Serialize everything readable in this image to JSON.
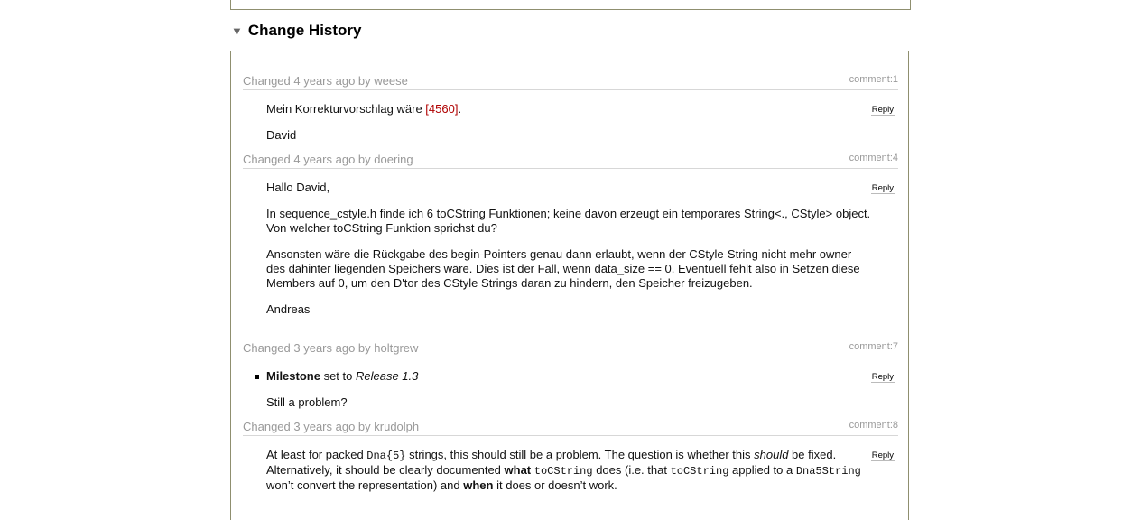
{
  "section": {
    "title": "Change History",
    "toggle_icon": "triangle-down-icon"
  },
  "changes": [
    {
      "meta": "Changed 4 years ago by weese",
      "comment_id": "comment:1",
      "reply": "Reply",
      "paragraphs": [
        "Mein Korrekturvorschlag wäre ",
        "[4560]",
        ".",
        "David"
      ]
    },
    {
      "meta": "Changed 4 years ago by doering",
      "comment_id": "comment:4",
      "reply": "Reply",
      "paragraphs": [
        "Hallo David,",
        "In sequence_cstyle.h finde ich 6 toCString Funktionen; keine davon erzeugt ein temporares String<., CStyle> object. Von welcher toCString Funktion sprichst du?",
        "Ansonsten wäre die Rückgabe des begin-Pointers genau dann erlaubt, wenn der CStyle-String nicht mehr owner des dahinter liegenden Speichers wäre. Dies ist der Fall, wenn data_size == 0. Eventuell fehlt also in Setzen diese Members auf 0, um den D'tor des CStyle Strings daran zu hindern, den Speicher freizugeben.",
        "Andreas"
      ]
    },
    {
      "meta": "Changed 3 years ago by holtgrew",
      "comment_id": "comment:7",
      "reply": "Reply",
      "field_name": "Milestone",
      "field_mid": " set to ",
      "field_value": "Release 1.3",
      "paragraphs": [
        "Still a problem?"
      ]
    },
    {
      "meta": "Changed 3 years ago by krudolph",
      "comment_id": "comment:8",
      "reply": "Reply",
      "parts": [
        "At least for packed ",
        "Dna{5}",
        " strings, this should still be a problem. The question is whether this ",
        "should",
        " be fixed. Alternatively, it should be clearly documented ",
        "what",
        " ",
        "toCString",
        " does (i.e. that ",
        "toCString",
        " applied to a ",
        "Dna5String",
        " won’t convert the representation) and ",
        "when",
        " it does or doesn’t work."
      ]
    }
  ]
}
